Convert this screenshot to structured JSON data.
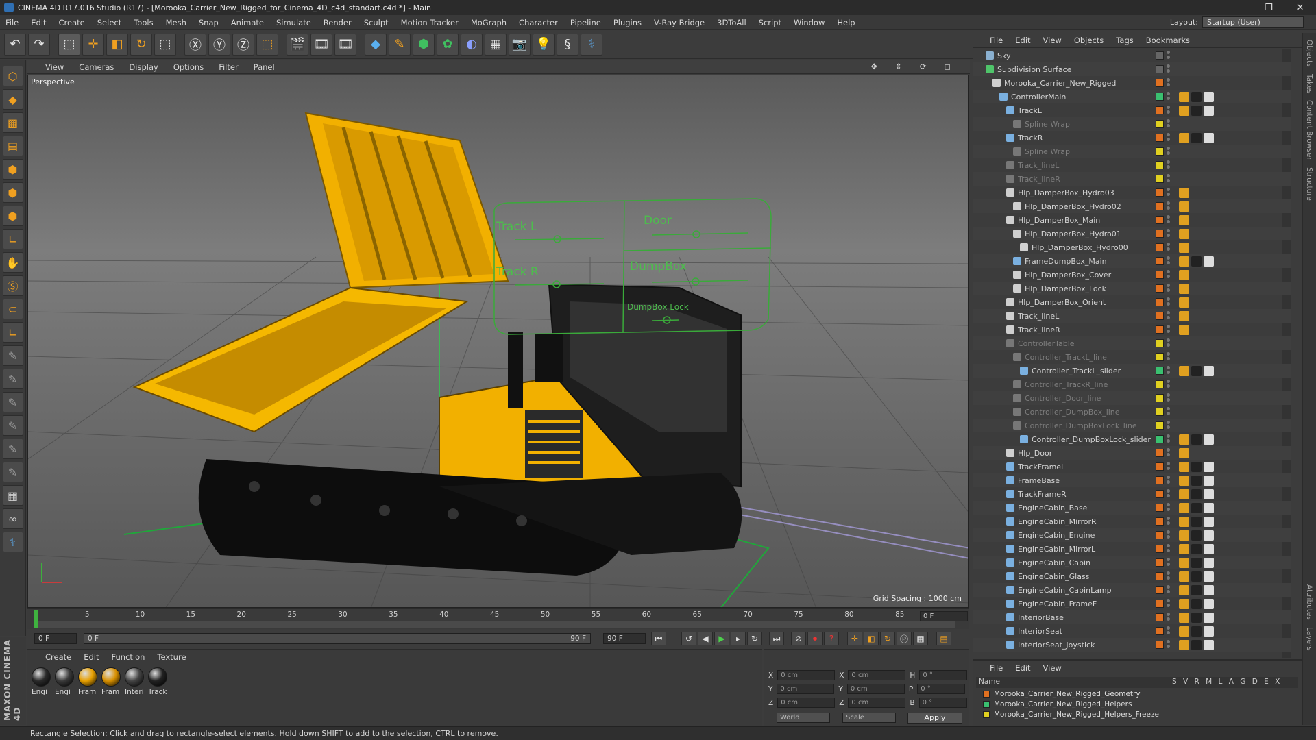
{
  "window": {
    "title": "CINEMA 4D R17.016 Studio (R17) - [Morooka_Carrier_New_Rigged_for_Cinema_4D_c4d_standart.c4d *] - Main",
    "controls": [
      "—",
      "❐",
      "✕"
    ]
  },
  "menu": [
    "File",
    "Edit",
    "Create",
    "Select",
    "Tools",
    "Mesh",
    "Snap",
    "Animate",
    "Simulate",
    "Render",
    "Sculpt",
    "Motion Tracker",
    "MoGraph",
    "Character",
    "Pipeline",
    "Plugins",
    "V-Ray Bridge",
    "3DToAll",
    "Script",
    "Window",
    "Help"
  ],
  "layout": {
    "label": "Layout:",
    "value": "Startup (User)"
  },
  "viewport": {
    "menu": [
      "View",
      "Cameras",
      "Display",
      "Options",
      "Filter",
      "Panel"
    ],
    "label": "Perspective",
    "grid_spacing": "Grid Spacing : 1000 cm",
    "controller": {
      "track_l": "Track L",
      "track_r": "Track R",
      "door": "Door",
      "dumpbox": "DumpBox",
      "dumpbox_lock": "DumpBox Lock"
    }
  },
  "timeline": {
    "ticks": [
      "0",
      "5",
      "10",
      "15",
      "20",
      "25",
      "30",
      "35",
      "40",
      "45",
      "50",
      "55",
      "60",
      "65",
      "70",
      "75",
      "80",
      "85",
      "90"
    ],
    "end_field": "0 F",
    "start": "0 F",
    "range_start": "0 F",
    "range_end": "90 F",
    "max": "90 F"
  },
  "materials": {
    "menu": [
      "Create",
      "Edit",
      "Function",
      "Texture"
    ],
    "items": [
      {
        "label": "Engi",
        "color": "#2a2a2a"
      },
      {
        "label": "Engi",
        "color": "#3a3a3a"
      },
      {
        "label": "Fram",
        "color": "#e8a000"
      },
      {
        "label": "Fram",
        "color": "#d89000"
      },
      {
        "label": "Interi",
        "color": "#444"
      },
      {
        "label": "Track",
        "color": "#222"
      }
    ]
  },
  "coords": {
    "x": "X",
    "y": "Y",
    "z": "Z",
    "h": "H",
    "p": "P",
    "b": "B",
    "pos": "0 cm",
    "rot": "0 °",
    "mode": "World",
    "mode2": "Scale",
    "apply": "Apply"
  },
  "objects": {
    "menu": [
      "File",
      "Edit",
      "View",
      "Objects",
      "Tags",
      "Bookmarks"
    ],
    "rows": [
      {
        "name": "Sky",
        "indent": 0,
        "dim": false,
        "icon": "#8ab0d0",
        "tag": "#666"
      },
      {
        "name": "Subdivision Surface",
        "indent": 0,
        "dim": false,
        "icon": "#4fc46a",
        "tag": "#666"
      },
      {
        "name": "Morooka_Carrier_New_Rigged",
        "indent": 1,
        "dim": false,
        "icon": "#cfcfcf",
        "tag": "#e07020"
      },
      {
        "name": "ControllerMain",
        "indent": 2,
        "dim": false,
        "icon": "#7ab0e0",
        "tag": "#3ac070"
      },
      {
        "name": "TrackL",
        "indent": 3,
        "dim": false,
        "icon": "#7ab0e0",
        "tag": "#e07020"
      },
      {
        "name": "Spline Wrap",
        "indent": 4,
        "dim": true,
        "icon": "#777",
        "tag": "#e0d020"
      },
      {
        "name": "TrackR",
        "indent": 3,
        "dim": false,
        "icon": "#7ab0e0",
        "tag": "#e07020"
      },
      {
        "name": "Spline Wrap",
        "indent": 4,
        "dim": true,
        "icon": "#777",
        "tag": "#e0d020"
      },
      {
        "name": "Track_lineL",
        "indent": 3,
        "dim": true,
        "icon": "#777",
        "tag": "#e0d020"
      },
      {
        "name": "Track_lineR",
        "indent": 3,
        "dim": true,
        "icon": "#777",
        "tag": "#e0d020"
      },
      {
        "name": "Hlp_DamperBox_Hydro03",
        "indent": 3,
        "dim": false,
        "icon": "#cfcfcf",
        "tag": "#e07020"
      },
      {
        "name": "Hlp_DamperBox_Hydro02",
        "indent": 4,
        "dim": false,
        "icon": "#cfcfcf",
        "tag": "#e07020"
      },
      {
        "name": "Hlp_DamperBox_Main",
        "indent": 3,
        "dim": false,
        "icon": "#cfcfcf",
        "tag": "#e07020"
      },
      {
        "name": "Hlp_DamperBox_Hydro01",
        "indent": 4,
        "dim": false,
        "icon": "#cfcfcf",
        "tag": "#e07020"
      },
      {
        "name": "Hlp_DamperBox_Hydro00",
        "indent": 5,
        "dim": false,
        "icon": "#cfcfcf",
        "tag": "#e07020"
      },
      {
        "name": "FrameDumpBox_Main",
        "indent": 4,
        "dim": false,
        "icon": "#7ab0e0",
        "tag": "#e07020"
      },
      {
        "name": "Hlp_DamperBox_Cover",
        "indent": 4,
        "dim": false,
        "icon": "#cfcfcf",
        "tag": "#e07020"
      },
      {
        "name": "Hlp_DamperBox_Lock",
        "indent": 4,
        "dim": false,
        "icon": "#cfcfcf",
        "tag": "#e07020"
      },
      {
        "name": "Hlp_DamperBox_Orient",
        "indent": 3,
        "dim": false,
        "icon": "#cfcfcf",
        "tag": "#e07020"
      },
      {
        "name": "Track_lineL",
        "indent": 3,
        "dim": false,
        "icon": "#cfcfcf",
        "tag": "#e07020"
      },
      {
        "name": "Track_lineR",
        "indent": 3,
        "dim": false,
        "icon": "#cfcfcf",
        "tag": "#e07020"
      },
      {
        "name": "ControllerTable",
        "indent": 3,
        "dim": true,
        "icon": "#777",
        "tag": "#e0d020"
      },
      {
        "name": "Controller_TrackL_line",
        "indent": 4,
        "dim": true,
        "icon": "#777",
        "tag": "#e0d020"
      },
      {
        "name": "Controller_TrackL_slider",
        "indent": 5,
        "dim": false,
        "icon": "#7ab0e0",
        "tag": "#3ac070"
      },
      {
        "name": "Controller_TrackR_line",
        "indent": 4,
        "dim": true,
        "icon": "#777",
        "tag": "#e0d020"
      },
      {
        "name": "Controller_Door_line",
        "indent": 4,
        "dim": true,
        "icon": "#777",
        "tag": "#e0d020"
      },
      {
        "name": "Controller_DumpBox_line",
        "indent": 4,
        "dim": true,
        "icon": "#777",
        "tag": "#e0d020"
      },
      {
        "name": "Controller_DumpBoxLock_line",
        "indent": 4,
        "dim": true,
        "icon": "#777",
        "tag": "#e0d020"
      },
      {
        "name": "Controller_DumpBoxLock_slider",
        "indent": 5,
        "dim": false,
        "icon": "#7ab0e0",
        "tag": "#3ac070"
      },
      {
        "name": "Hlp_Door",
        "indent": 3,
        "dim": false,
        "icon": "#cfcfcf",
        "tag": "#e07020"
      },
      {
        "name": "TrackFrameL",
        "indent": 3,
        "dim": false,
        "icon": "#7ab0e0",
        "tag": "#e07020"
      },
      {
        "name": "FrameBase",
        "indent": 3,
        "dim": false,
        "icon": "#7ab0e0",
        "tag": "#e07020"
      },
      {
        "name": "TrackFrameR",
        "indent": 3,
        "dim": false,
        "icon": "#7ab0e0",
        "tag": "#e07020"
      },
      {
        "name": "EngineCabin_Base",
        "indent": 3,
        "dim": false,
        "icon": "#7ab0e0",
        "tag": "#e07020"
      },
      {
        "name": "EngineCabin_MirrorR",
        "indent": 3,
        "dim": false,
        "icon": "#7ab0e0",
        "tag": "#e07020"
      },
      {
        "name": "EngineCabin_Engine",
        "indent": 3,
        "dim": false,
        "icon": "#7ab0e0",
        "tag": "#e07020"
      },
      {
        "name": "EngineCabin_MirrorL",
        "indent": 3,
        "dim": false,
        "icon": "#7ab0e0",
        "tag": "#e07020"
      },
      {
        "name": "EngineCabin_Cabin",
        "indent": 3,
        "dim": false,
        "icon": "#7ab0e0",
        "tag": "#e07020"
      },
      {
        "name": "EngineCabin_Glass",
        "indent": 3,
        "dim": false,
        "icon": "#7ab0e0",
        "tag": "#e07020"
      },
      {
        "name": "EngineCabin_CabinLamp",
        "indent": 3,
        "dim": false,
        "icon": "#7ab0e0",
        "tag": "#e07020"
      },
      {
        "name": "EngineCabin_FrameF",
        "indent": 3,
        "dim": false,
        "icon": "#7ab0e0",
        "tag": "#e07020"
      },
      {
        "name": "InteriorBase",
        "indent": 3,
        "dim": false,
        "icon": "#7ab0e0",
        "tag": "#e07020"
      },
      {
        "name": "InteriorSeat",
        "indent": 3,
        "dim": false,
        "icon": "#7ab0e0",
        "tag": "#e07020"
      },
      {
        "name": "InteriorSeat_Joystick",
        "indent": 3,
        "dim": false,
        "icon": "#7ab0e0",
        "tag": "#e07020"
      }
    ]
  },
  "layers": {
    "menu": [
      "File",
      "Edit",
      "View"
    ],
    "header": "Name",
    "cols": "S V R M L A G D E X",
    "rows": [
      {
        "name": "Morooka_Carrier_New_Rigged_Geometry",
        "color": "#e07020"
      },
      {
        "name": "Morooka_Carrier_New_Rigged_Helpers",
        "color": "#3ac070"
      },
      {
        "name": "Morooka_Carrier_New_Rigged_Helpers_Freeze",
        "color": "#e0d020"
      }
    ]
  },
  "side_tabs": [
    "Objects",
    "Takes",
    "Content Browser",
    "Structure"
  ],
  "attr_tabs": [
    "Attributes",
    "Layers"
  ],
  "status": "Rectangle Selection: Click and drag to rectangle-select elements. Hold down SHIFT to add to the selection, CTRL to remove.",
  "maxon": "MAXON CINEMA 4D"
}
